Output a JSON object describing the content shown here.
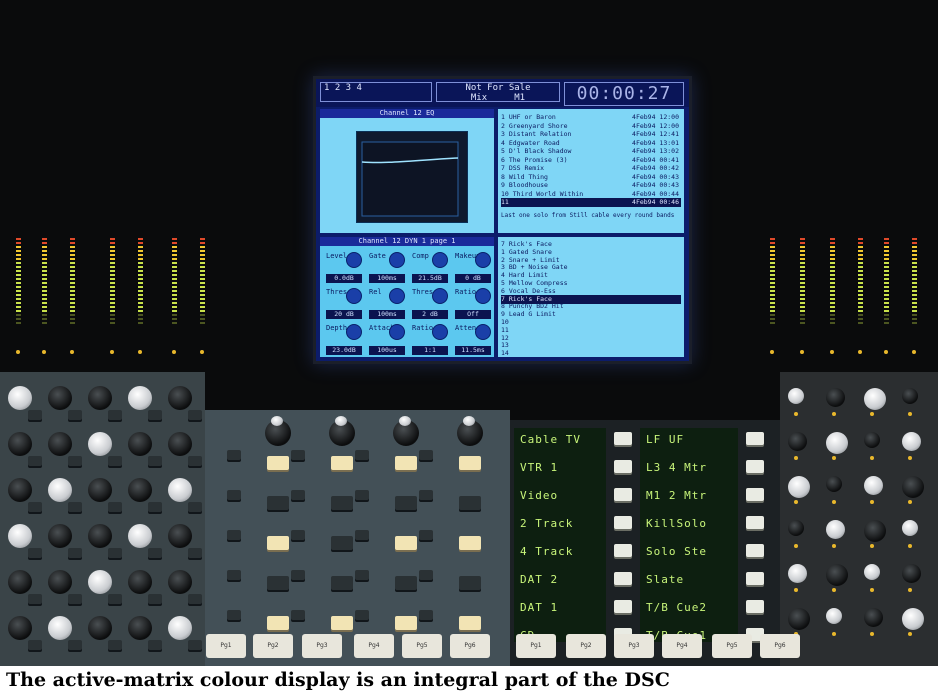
{
  "caption": "The active-matrix colour display is an integral part of the DSC",
  "screen": {
    "top_box_left": "1 2 3 4",
    "title": "Not For Sale",
    "mode": "Mix",
    "mode_value": "M1",
    "timecode": "00:00:27",
    "upper_pane_title": "Channel 12 EQ",
    "lower_pane_title": "Channel 12 DYN 1 page 1",
    "note_text": "Last one solo from Still cable every round bands",
    "cue_list": [
      {
        "n": "1",
        "name": "UHF or Baron",
        "date": "4Feb94 12:00"
      },
      {
        "n": "2",
        "name": "Greenyard Shore",
        "date": "4Feb94 12:00"
      },
      {
        "n": "3",
        "name": "Distant Relation",
        "date": "4Feb94 12:41"
      },
      {
        "n": "4",
        "name": "Edgwater Road",
        "date": "4Feb94 13:01"
      },
      {
        "n": "5",
        "name": "D'l Black Shadow",
        "date": "4Feb94 13:02"
      },
      {
        "n": "6",
        "name": "The Promise (3)",
        "date": "4Feb94 00:41"
      },
      {
        "n": "7",
        "name": "DSS Remix",
        "date": "4Feb94 00:42"
      },
      {
        "n": "8",
        "name": "Wild Thing",
        "date": "4Feb94 00:43"
      },
      {
        "n": "9",
        "name": "Bloodhouse",
        "date": "4Feb94 00:43"
      },
      {
        "n": "10",
        "name": "Third World Within",
        "date": "4Feb94 00:44"
      },
      {
        "n": "11",
        "name": "",
        "date": "4Feb94 00:46"
      }
    ],
    "preset_list": [
      {
        "n": "7",
        "name": "Rick's Face",
        "sel": false
      },
      {
        "n": "1",
        "name": "Gated Snare",
        "sel": false
      },
      {
        "n": "2",
        "name": "Snare + Limit",
        "sel": false
      },
      {
        "n": "3",
        "name": "BD + Noise Gate",
        "sel": false
      },
      {
        "n": "4",
        "name": "Hard Limit",
        "sel": false
      },
      {
        "n": "5",
        "name": "Mellow Compress",
        "sel": false
      },
      {
        "n": "6",
        "name": "Vocal De-Ess",
        "sel": false
      },
      {
        "n": "7",
        "name": "Rick's Face",
        "sel": true
      },
      {
        "n": "8",
        "name": "Punchy BD2 Hit",
        "sel": false
      },
      {
        "n": "9",
        "name": "Lead G Limit",
        "sel": false
      },
      {
        "n": "10",
        "name": "",
        "sel": false
      },
      {
        "n": "11",
        "name": "",
        "sel": false
      },
      {
        "n": "12",
        "name": "",
        "sel": false
      },
      {
        "n": "13",
        "name": "",
        "sel": false
      },
      {
        "n": "14",
        "name": "",
        "sel": false
      }
    ],
    "controls": [
      {
        "label": "Level",
        "value": "0.0dB"
      },
      {
        "label": "Gate",
        "value": "100ms"
      },
      {
        "label": "Comp",
        "value": "21.5dB"
      },
      {
        "label": "Makeup",
        "value": "0 dB"
      },
      {
        "label": "Thres",
        "value": "20 dB"
      },
      {
        "label": "Rel",
        "value": "100ms"
      },
      {
        "label": "Thres",
        "value": "2 dB"
      },
      {
        "label": "Ratio",
        "value": "Off"
      },
      {
        "label": "Depth",
        "value": "23.0dB"
      },
      {
        "label": "Attack",
        "value": "100us"
      },
      {
        "label": "Ratio",
        "value": "1:1"
      },
      {
        "label": "Atten",
        "value": "11.5ms"
      }
    ]
  },
  "source_select": {
    "left": [
      "Cable TV",
      "VTR 1",
      "Video",
      "2 Track",
      "4 Track",
      "DAT 2",
      "DAT 1",
      "CD"
    ],
    "right": [
      "LF UF",
      "L3 4 Mtr",
      "M1 2 Mtr",
      "KillSolo",
      "Solo Ste",
      "Slate",
      "T/B Cue2",
      "T/B Cue1"
    ]
  },
  "function_keys": [
    "Pg1",
    "Pg2",
    "Pg3",
    "Pg4",
    "Pg5",
    "Pg6",
    "Pg1",
    "Pg2",
    "Pg3",
    "Pg4",
    "Pg5",
    "Pg6"
  ]
}
